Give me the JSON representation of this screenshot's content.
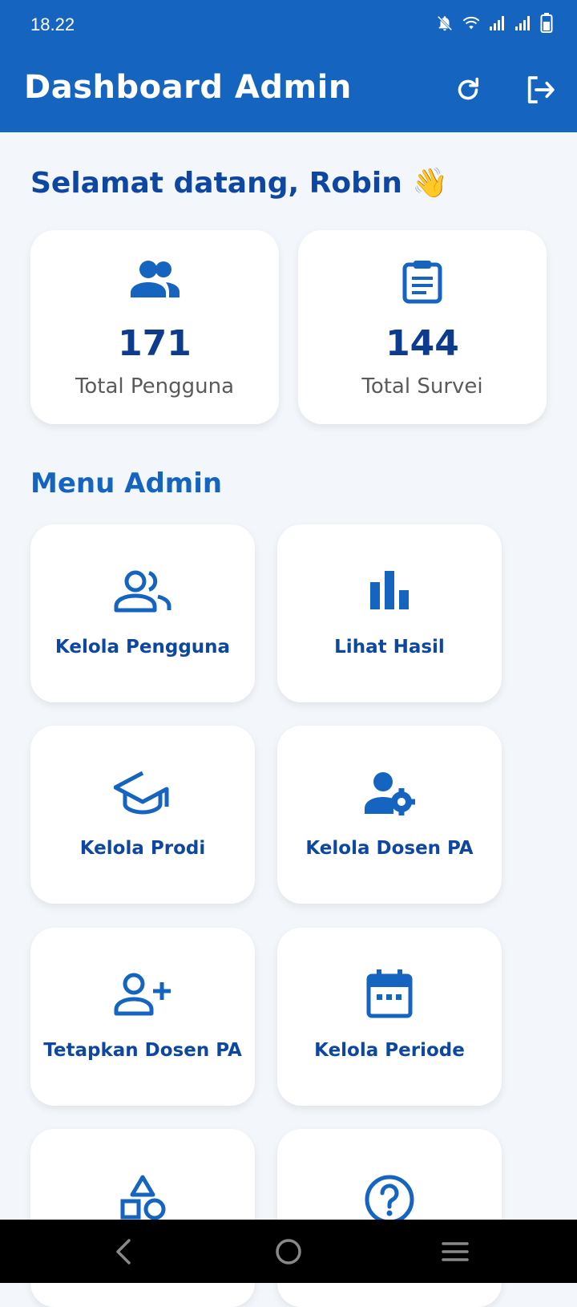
{
  "status_bar": {
    "time": "18.22"
  },
  "appbar": {
    "title": "Dashboard Admin"
  },
  "welcome": {
    "text": "Selamat datang, Robin 👋"
  },
  "stats": [
    {
      "value": "171",
      "label": "Total Pengguna",
      "icon": "users-icon"
    },
    {
      "value": "144",
      "label": "Total Survei",
      "icon": "clipboard-icon"
    }
  ],
  "menu": {
    "title": "Menu Admin",
    "items": [
      {
        "label": "Kelola Pengguna",
        "icon": "users-outline-icon"
      },
      {
        "label": "Lihat Hasil",
        "icon": "bar-chart-icon"
      },
      {
        "label": "Kelola Prodi",
        "icon": "graduation-cap-icon"
      },
      {
        "label": "Kelola Dosen PA",
        "icon": "user-gear-icon"
      },
      {
        "label": "Tetapkan Dosen PA",
        "icon": "user-add-icon"
      },
      {
        "label": "Kelola Periode",
        "icon": "calendar-icon"
      },
      {
        "label": "",
        "icon": "shapes-icon"
      },
      {
        "label": "",
        "icon": "help-circle-icon"
      }
    ]
  },
  "colors": {
    "primary": "#1565C0",
    "dark_blue": "#0D47A1",
    "background": "#F3F7FB"
  }
}
